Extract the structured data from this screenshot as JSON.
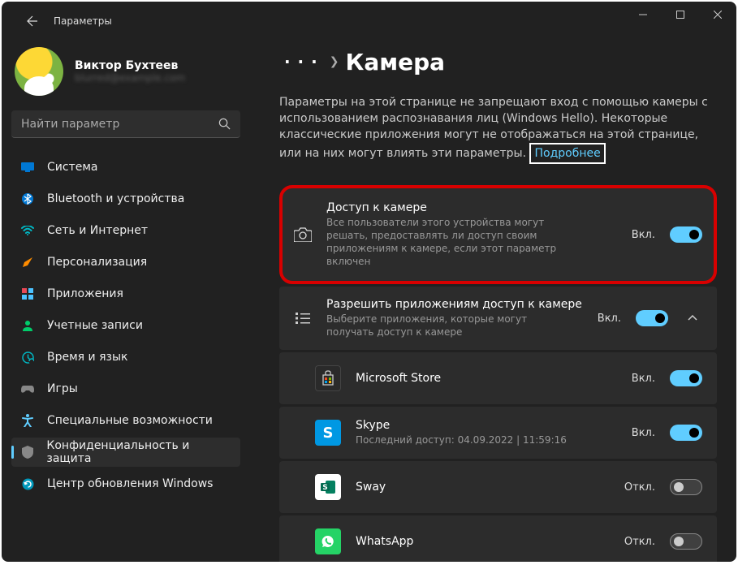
{
  "window": {
    "title": "Параметры"
  },
  "profile": {
    "name": "Виктор Бухтеев",
    "email": "blurred@example.com"
  },
  "search": {
    "placeholder": "Найти параметр"
  },
  "nav": [
    {
      "label": "Система",
      "color": "#0078d4"
    },
    {
      "label": "Bluetooth и устройства",
      "color": "#0078d4"
    },
    {
      "label": "Сеть и Интернет",
      "color": "#00b7c3"
    },
    {
      "label": "Персонализация",
      "color": "#ff8c00"
    },
    {
      "label": "Приложения",
      "color": "#e74856"
    },
    {
      "label": "Учетные записи",
      "color": "#00cc6a"
    },
    {
      "label": "Время и язык",
      "color": "#00b7c3"
    },
    {
      "label": "Игры",
      "color": "#888"
    },
    {
      "label": "Специальные возможности",
      "color": "#60cdff"
    },
    {
      "label": "Конфиденциальность и защита",
      "color": "#888",
      "selected": true
    },
    {
      "label": "Центр обновления Windows",
      "color": "#0099bc"
    }
  ],
  "header": {
    "breadcrumb_ellipsis": "· · ·",
    "page_title": "Камера"
  },
  "description": {
    "text": "Параметры на этой странице не запрещают вход с помощью камеры с использованием распознавания лиц (Windows Hello). Некоторые классические приложения могут не отображаться на этой странице, или на них могут влиять эти параметры.",
    "link": "Подробнее"
  },
  "cards": {
    "camera_access": {
      "title": "Доступ к камере",
      "subtitle": "Все пользователи этого устройства могут решать, предоставлять ли доступ своим приложениям к камере, если этот параметр включен",
      "state": "Вкл.",
      "on": true
    },
    "app_access": {
      "title": "Разрешить приложениям доступ к камере",
      "subtitle": "Выберите приложения, которые могут получать доступ к камере",
      "state": "Вкл.",
      "on": true
    },
    "apps": [
      {
        "name": "Microsoft Store",
        "state": "Вкл.",
        "on": true,
        "kind": "store"
      },
      {
        "name": "Skype",
        "sub": "Последний доступ: 04.09.2022  |  11:59:16",
        "state": "Вкл.",
        "on": true,
        "kind": "skype"
      },
      {
        "name": "Sway",
        "state": "Откл.",
        "on": false,
        "kind": "sway"
      },
      {
        "name": "WhatsApp",
        "state": "Откл.",
        "on": false,
        "kind": "whatsapp"
      }
    ]
  }
}
